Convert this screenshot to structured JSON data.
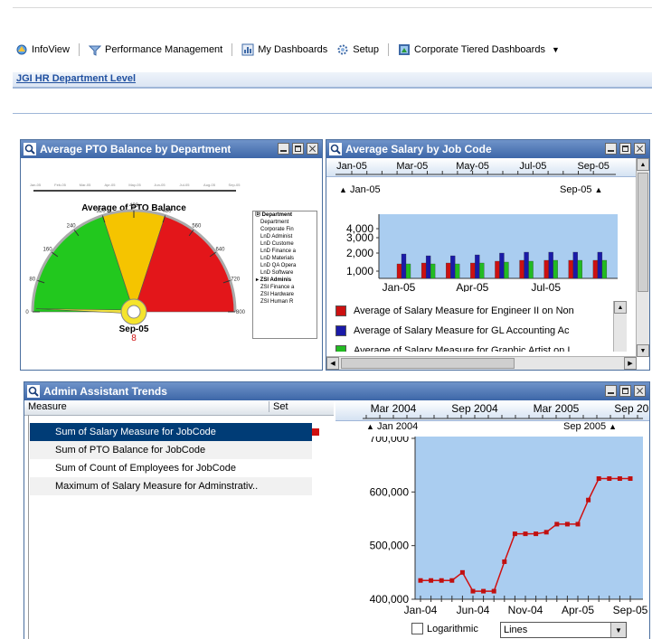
{
  "nav": {
    "items": [
      {
        "label": "InfoView",
        "icon": "infoview-icon"
      },
      {
        "label": "Performance Management",
        "icon": "performance-icon"
      },
      {
        "label": "My Dashboards",
        "icon": "dashboards-icon"
      },
      {
        "label": "Setup",
        "icon": "setup-icon"
      },
      {
        "label": "Corporate Tiered Dashboards",
        "icon": "corporate-dashboards-icon"
      }
    ]
  },
  "dept_bar": {
    "label": "JGI HR Department Level"
  },
  "panel_pto": {
    "title": "Average PTO Balance by Department",
    "gauge": {
      "title": "Average of PTO Balance",
      "ticks": [
        "0",
        "80",
        "160",
        "240",
        "320",
        "400",
        "480",
        "560",
        "640",
        "720",
        "800"
      ],
      "period": "Sep-05",
      "value_label": "8",
      "value": 8,
      "min": 0,
      "max": 800,
      "bands": [
        {
          "from": 0,
          "to": 320,
          "color": "#22c81e"
        },
        {
          "from": 320,
          "to": 480,
          "color": "#f5c400"
        },
        {
          "from": 480,
          "to": 800,
          "color": "#e3161a"
        }
      ]
    },
    "slider_ticks": [
      "Jan-05",
      "Feb-05",
      "Mar-05",
      "Apr-05",
      "May-05",
      "Jun-05",
      "Jul-05",
      "Aug-05",
      "Sep-05"
    ],
    "list": {
      "header": "Department",
      "items": [
        "Department",
        "Corporate Fin",
        "LnD Administ",
        "LnD Custome",
        "LnD Finance a",
        "LnD Materials",
        "LnD QA Opera",
        "LnD Software",
        "ZSI Adminis",
        "ZSI Finance a",
        "ZSI Hardware",
        "ZSI Human R"
      ],
      "selected": "ZSI Adminis"
    }
  },
  "panel_salary": {
    "title": "Average Salary by Job Code",
    "timeline_labels": [
      "Jan-05",
      "Mar-05",
      "May-05",
      "Jul-05",
      "Sep-05"
    ],
    "range_start": "Jan-05",
    "range_end": "Sep-05",
    "legend": [
      {
        "label": "Average of Salary Measure for Engineer II on Non",
        "color": "#cc1111"
      },
      {
        "label": "Average of Salary Measure for GL Accounting Ac",
        "color": "#1a1aa8"
      },
      {
        "label": "Average of Salary Measure for Graphic Artist on I",
        "color": "#22bb22"
      }
    ]
  },
  "panel_admin": {
    "title": "Admin Assistant Trends",
    "columns": [
      "Measure",
      "Set"
    ],
    "rows": [
      "Sum of Salary Measure for JobCode",
      "Sum of PTO Balance for JobCode",
      "Sum of Count of Employees for JobCode",
      "Maximum of Salary Measure for Adminstrativ.."
    ],
    "selected_row": 0,
    "timeline_labels": [
      "Mar 2004",
      "Sep 2004",
      "Mar 2005",
      "Sep 2005"
    ],
    "range_start": "Jan 2004",
    "range_end": "Sep 2005",
    "logarithmic_label": "Logarithmic",
    "logarithmic_checked": false,
    "chart_type_value": "Lines"
  },
  "chart_data": [
    {
      "type": "bar",
      "categories": [
        "Jan-05",
        "Feb-05",
        "Mar-05",
        "Apr-05",
        "May-05",
        "Jun-05",
        "Jul-05",
        "Aug-05",
        "Sep-05"
      ],
      "x_tick_labels": [
        "Jan-05",
        "Apr-05",
        "Jul-05"
      ],
      "y_tick_labels": [
        "1,000",
        "2,000",
        "3,000",
        "4,000"
      ],
      "ylim": [
        1000,
        4000
      ],
      "series": [
        {
          "name": "Average of Salary Measure for Engineer II on Non",
          "values": [
            1400,
            1450,
            1450,
            1450,
            1550,
            1600,
            1600,
            1600,
            1600
          ]
        },
        {
          "name": "Average of Salary Measure for GL Accounting Ac",
          "values": [
            1950,
            1850,
            1850,
            1900,
            2000,
            2050,
            2050,
            2050,
            2050
          ]
        },
        {
          "name": "Average of Salary Measure for Graphic Artist on I",
          "values": [
            1400,
            1400,
            1400,
            1450,
            1500,
            1550,
            1600,
            1600,
            1600
          ]
        }
      ]
    },
    {
      "type": "line",
      "x": [
        "Jan-04",
        "Feb-04",
        "Mar-04",
        "Apr-04",
        "May-04",
        "Jun-04",
        "Jul-04",
        "Aug-04",
        "Sep-04",
        "Oct-04",
        "Nov-04",
        "Dec-04",
        "Jan-05",
        "Feb-05",
        "Mar-05",
        "Apr-05",
        "May-05",
        "Jun-05",
        "Jul-05",
        "Aug-05",
        "Sep-05"
      ],
      "x_tick_labels": [
        "Jan-04",
        "Jun-04",
        "Nov-04",
        "Apr-05",
        "Sep-05"
      ],
      "y_tick_labels": [
        "400,000",
        "500,000",
        "600,000",
        "700,000"
      ],
      "ylim": [
        400000,
        700000
      ],
      "series": [
        {
          "values": [
            435000,
            435000,
            435000,
            435000,
            450000,
            415000,
            415000,
            415000,
            470000,
            522000,
            522000,
            522000,
            525000,
            540000,
            540000,
            540000,
            585000,
            625000,
            625000,
            625000,
            625000
          ]
        }
      ]
    }
  ]
}
